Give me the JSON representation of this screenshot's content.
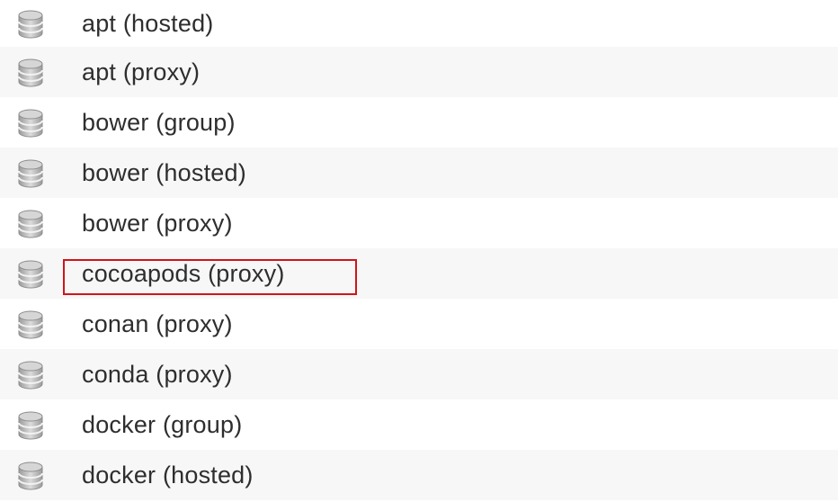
{
  "repositories": [
    {
      "label": "apt (hosted)",
      "icon": "database-icon"
    },
    {
      "label": "apt (proxy)",
      "icon": "database-icon"
    },
    {
      "label": "bower (group)",
      "icon": "database-icon"
    },
    {
      "label": "bower (hosted)",
      "icon": "database-icon"
    },
    {
      "label": "bower (proxy)",
      "icon": "database-icon"
    },
    {
      "label": "cocoapods (proxy)",
      "icon": "database-icon"
    },
    {
      "label": "conan (proxy)",
      "icon": "database-icon"
    },
    {
      "label": "conda (proxy)",
      "icon": "database-icon"
    },
    {
      "label": "docker (group)",
      "icon": "database-icon"
    },
    {
      "label": "docker (hosted)",
      "icon": "database-icon"
    }
  ],
  "highlighted_item": "cocoapods (proxy)",
  "colors": {
    "highlight_border": "#d0141b",
    "row_alt": "#f7f7f7",
    "text": "#2e2e2e"
  }
}
